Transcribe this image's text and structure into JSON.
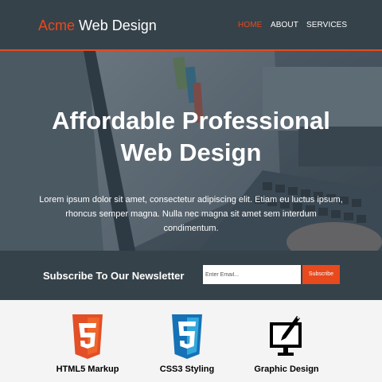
{
  "header": {
    "brand_highlight": "Acme",
    "brand_rest": " Web Design",
    "nav": [
      {
        "label": "HOME",
        "current": true
      },
      {
        "label": "ABOUT",
        "current": false
      },
      {
        "label": "SERVICES",
        "current": false
      }
    ]
  },
  "showcase": {
    "title": "Affordable Professional Web Design",
    "text": "Lorem ipsum dolor sit amet, consectetur adipiscing elit. Etiam eu luctus ipsum, rhoncus semper magna. Nulla nec magna sit amet sem interdum condimentum."
  },
  "newsletter": {
    "title": "Subscribe To Our Newsletter",
    "email_placeholder": "Enter Email...",
    "button_label": "Subscribe"
  },
  "boxes": [
    {
      "title": "HTML5 Markup",
      "icon": "html5-logo-icon"
    },
    {
      "title": "CSS3 Styling",
      "icon": "css3-logo-icon"
    },
    {
      "title": "Graphic Design",
      "icon": "graphic-design-icon"
    }
  ],
  "colors": {
    "accent": "#e8491d",
    "dark": "#35424a",
    "light_bg": "#f4f4f4"
  }
}
